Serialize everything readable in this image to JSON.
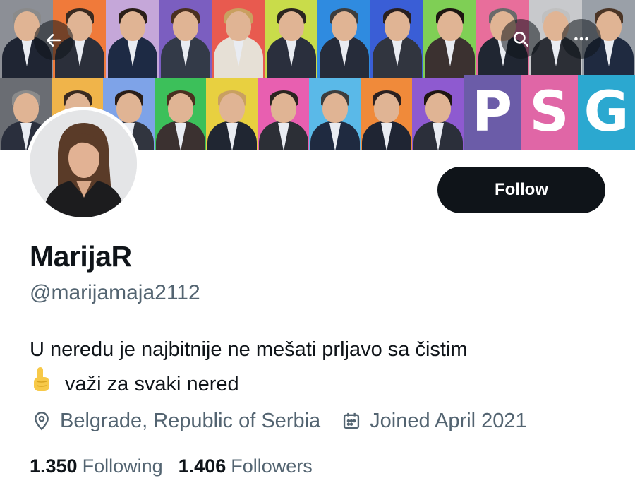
{
  "banner": {
    "brand_letters": [
      "P",
      "S",
      "G"
    ],
    "brand_colors": [
      "#6b5ca8",
      "#e066a6",
      "#2ba8d0"
    ],
    "tile_colors_top": [
      "#8c8f96",
      "#f07a3a",
      "#c5a7d9",
      "#7b5ec0",
      "#e85a4f",
      "#c9dc4a",
      "#2f8be0",
      "#3a5ed6",
      "#7fcf55",
      "#e86e9b",
      "#c8c9cc",
      "#9aa0a8"
    ],
    "tile_colors_bottom": [
      "#6a6d73",
      "#f0b44a",
      "#7ea3e8",
      "#3cc05a",
      "#e8d040",
      "#e85fb0",
      "#5ab9e8",
      "#f08a3a",
      "#8e5ad0"
    ]
  },
  "nav": {
    "back_icon": "arrow-left-icon",
    "search_icon": "search-icon",
    "more_icon": "more-horizontal-icon"
  },
  "profile": {
    "display_name": "MarijaR",
    "handle": "@marijamaja2112",
    "follow_label": "Follow",
    "bio_line1": "U neredu je najbitnije ne mešati prljavo sa čistim",
    "bio_emoji": "☝️",
    "bio_line2": "važi za svaki nered",
    "location": "Belgrade, Republic of Serbia",
    "joined": "Joined April 2021",
    "following_count": "1.350",
    "following_label": "Following",
    "followers_count": "1.406",
    "followers_label": "Followers"
  },
  "colors": {
    "primary_text": "#0f1419",
    "secondary_text": "#536471",
    "follow_bg": "#0f1419"
  }
}
